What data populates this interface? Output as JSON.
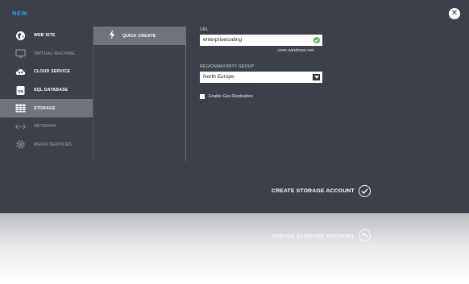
{
  "dialog": {
    "title": "NEW",
    "close_icon": "close-icon",
    "close_glyph": "✕"
  },
  "nav": {
    "items": [
      {
        "label": "WEB SITE",
        "icon": "globe-icon",
        "state": "enabled"
      },
      {
        "label": "VIRTUAL MACHINE",
        "icon": "monitor-icon",
        "state": "disabled"
      },
      {
        "label": "CLOUD SERVICE",
        "icon": "cloud-gear-icon",
        "state": "enabled"
      },
      {
        "label": "SQL DATABASE",
        "icon": "database-icon",
        "state": "enabled"
      },
      {
        "label": "STORAGE",
        "icon": "storage-grid-icon",
        "state": "selected"
      },
      {
        "label": "NETWORK",
        "icon": "network-icon",
        "state": "disabled"
      },
      {
        "label": "MEDIA SERVICES",
        "icon": "media-gear-icon",
        "state": "disabled"
      }
    ]
  },
  "subnav": {
    "quick_create": {
      "label": "QUICK CREATE",
      "icon": "lightning-icon"
    }
  },
  "form": {
    "url_label": "URL",
    "url_value": "enterprisecoding",
    "url_suffix": ".core.windows.net",
    "region_label": "REGION/AFFINITY GROUP",
    "region_value": "North Europe",
    "geo_replication_label": "Enable Geo-Replication",
    "geo_replication_checked": true
  },
  "action": {
    "create_label": "CREATE STORAGE ACCOUNT",
    "icon": "checkmark-circle-icon"
  },
  "colors": {
    "panel_bg": "#3b4049",
    "accent": "#35a1dc",
    "selected_bg": "#6e737c",
    "valid_green": "#5cb85c"
  }
}
